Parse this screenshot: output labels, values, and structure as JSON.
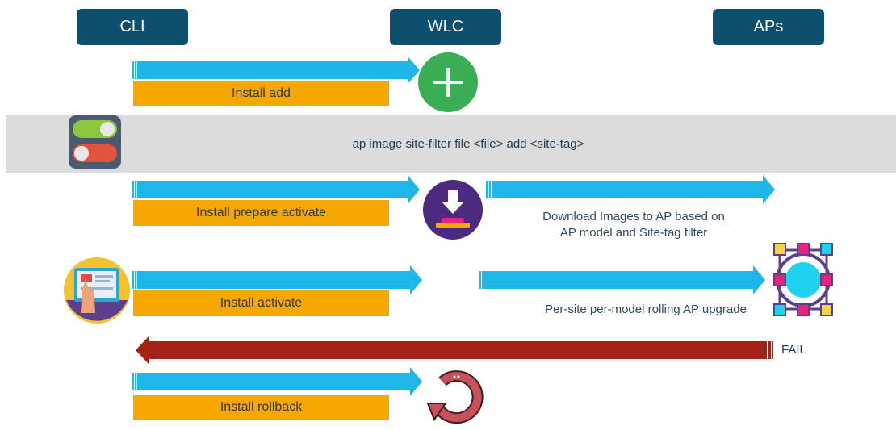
{
  "headers": {
    "cli": "CLI",
    "wlc": "WLC",
    "aps": "APs"
  },
  "steps": {
    "add": "Install add",
    "prepare": "Install prepare activate",
    "activate": "Install activate",
    "rollback": "Install rollback"
  },
  "band": {
    "command": "ap image site-filter file <file> add <site-tag>"
  },
  "notes": {
    "download_line1": "Download Images to AP based on",
    "download_line2": "AP model and Site-tag filter",
    "rolling": "Per-site per-model rolling AP upgrade",
    "fail": "FAIL"
  },
  "colors": {
    "header_bg": "#0d4f6c",
    "arrow_blue": "#1fb6ea",
    "step_orange": "#f7a800",
    "fail_red": "#a52216",
    "band_gray": "#dcdcdc",
    "plus_green": "#3aae55",
    "download_purple": "#4b2a7f",
    "rollback_red": "#c8505a"
  },
  "icons": [
    "plus-icon",
    "toggle-switch-icon",
    "download-icon",
    "touch-screen-icon",
    "network-hub-icon",
    "rollback-icon"
  ]
}
